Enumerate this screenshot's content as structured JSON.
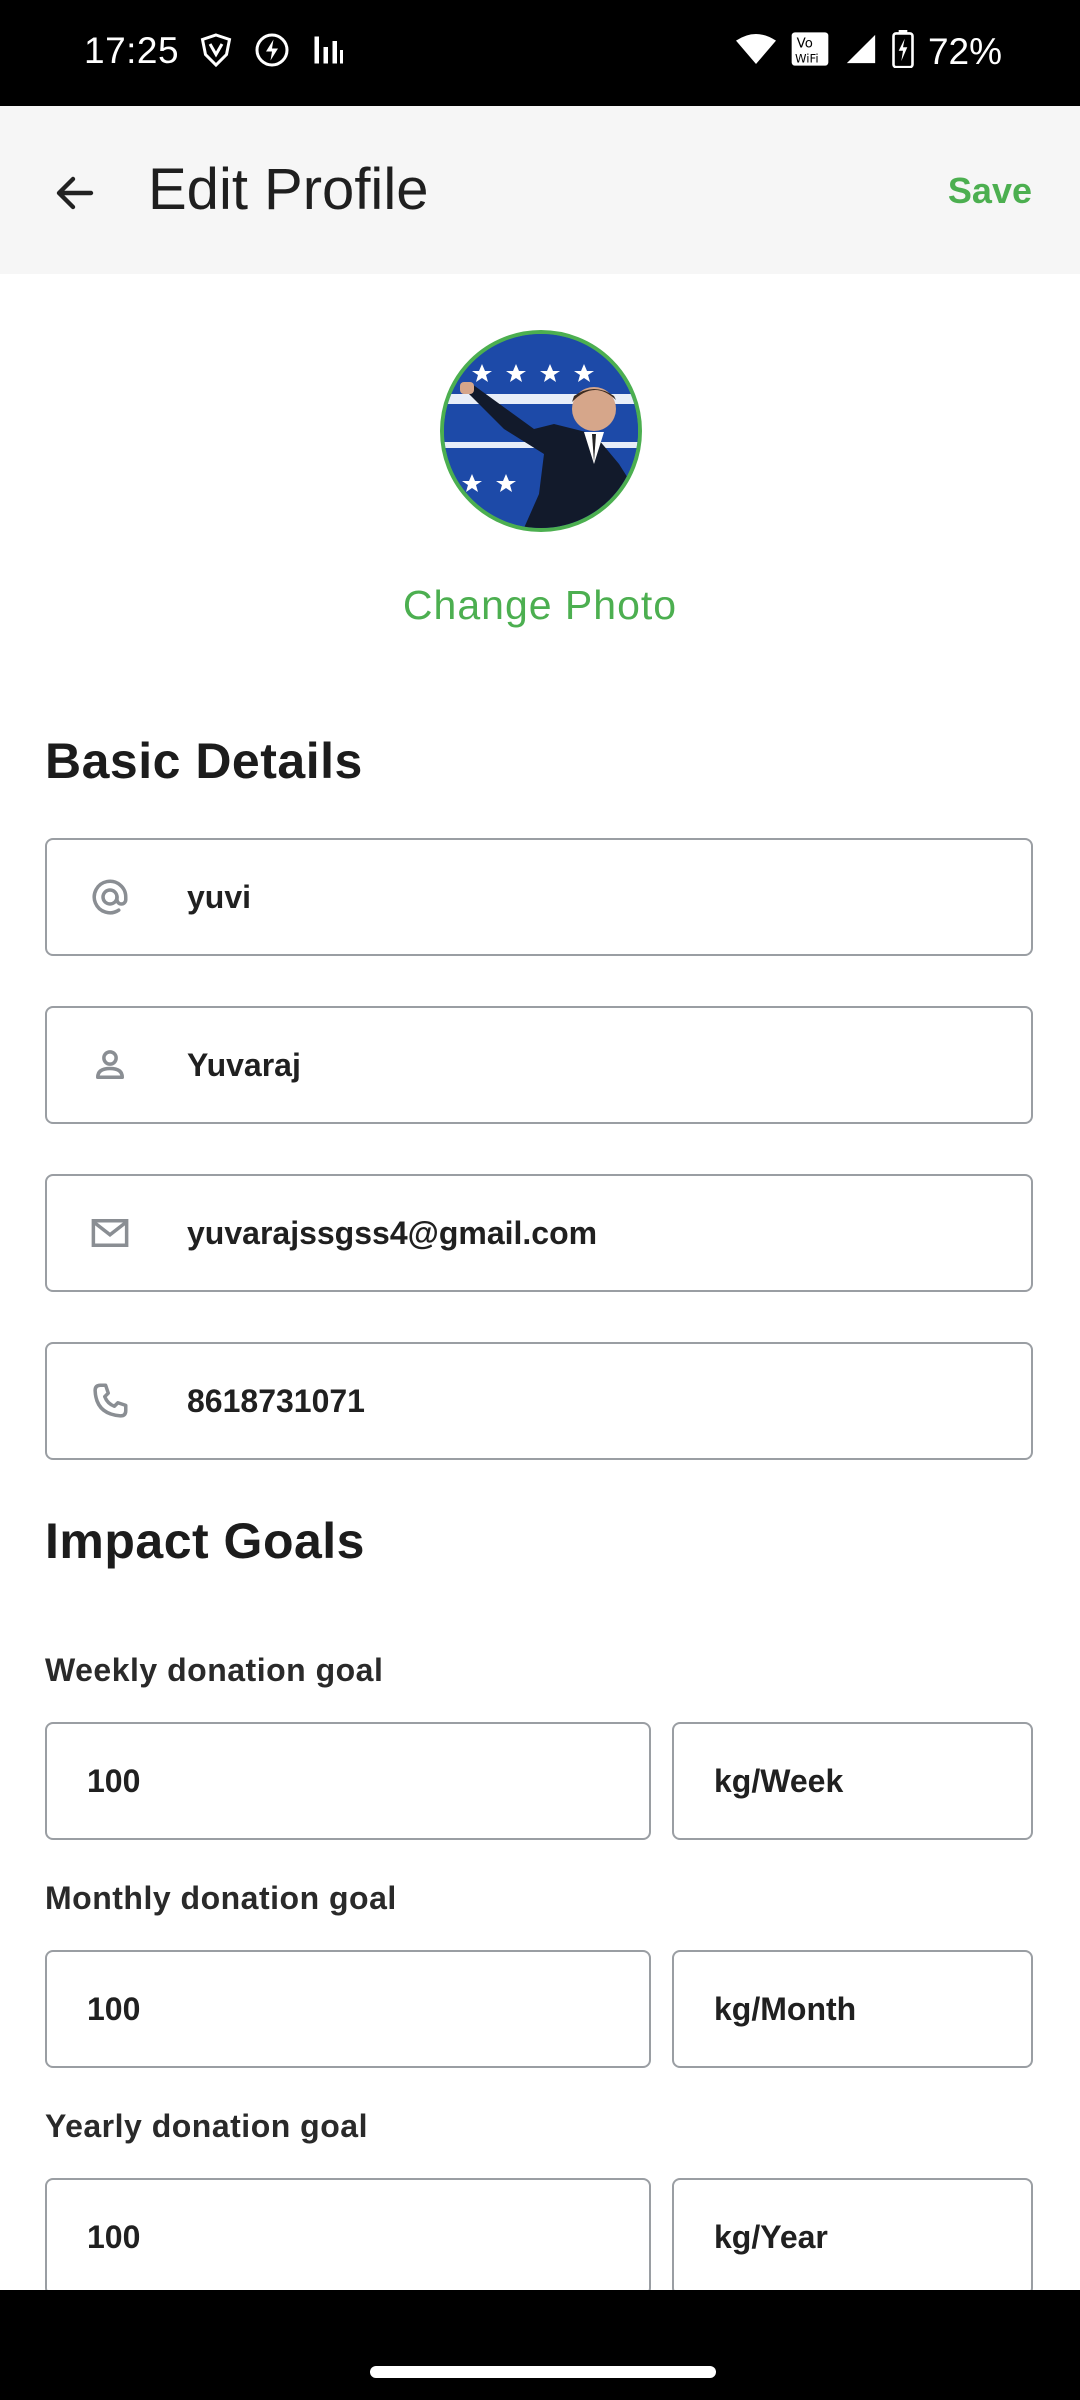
{
  "status_bar": {
    "time": "17:25",
    "battery": "72%",
    "icons": [
      "vpn-shield-icon",
      "bolt-icon",
      "signal-bars-icon",
      "wifi-icon",
      "vowifi-icon",
      "cell-signal-icon",
      "battery-charging-icon"
    ]
  },
  "header": {
    "title": "Edit Profile",
    "save_label": "Save"
  },
  "profile": {
    "change_photo_label": "Change Photo"
  },
  "basic_details": {
    "title": "Basic Details",
    "username": "yuvi",
    "name": "Yuvaraj",
    "email": "yuvarajssgss4@gmail.com",
    "phone": "8618731071"
  },
  "impact_goals": {
    "title": "Impact Goals",
    "weekly": {
      "label": "Weekly donation goal",
      "value": "100",
      "unit": "kg/Week"
    },
    "monthly": {
      "label": "Monthly donation goal",
      "value": "100",
      "unit": "kg/Month"
    },
    "yearly": {
      "label": "Yearly donation goal",
      "value": "100",
      "unit": "kg/Year"
    }
  },
  "colors": {
    "accent": "#4caf50",
    "field_border": "#9a9ea3",
    "appbar_bg": "#f6f6f6"
  }
}
